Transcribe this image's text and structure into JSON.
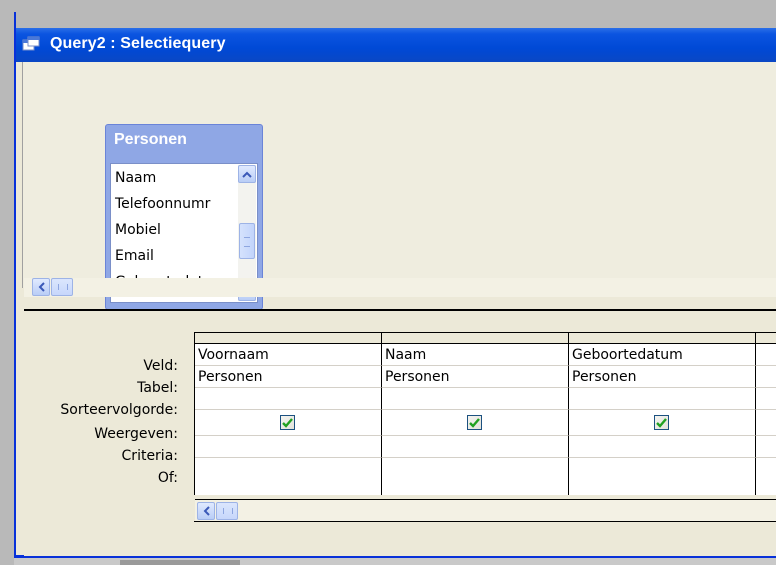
{
  "window": {
    "title": "Query2 : Selectiequery"
  },
  "table_box": {
    "title": "Personen",
    "fields": [
      "Naam",
      "Telefoonnumr",
      "Mobiel",
      "Email",
      "Geboortedatu"
    ]
  },
  "grid": {
    "row_labels": {
      "field": "Veld:",
      "table": "Tabel:",
      "sort": "Sorteervolgorde:",
      "show": "Weergeven:",
      "criteria": "Criteria:",
      "or": "Of:"
    },
    "columns": [
      {
        "field": "Voornaam",
        "table": "Personen",
        "sort": "",
        "show": true,
        "criteria": "",
        "or": ""
      },
      {
        "field": "Naam",
        "table": "Personen",
        "sort": "",
        "show": true,
        "criteria": "",
        "or": ""
      },
      {
        "field": "Geboortedatum",
        "table": "Personen",
        "sort": "",
        "show": true,
        "criteria": "",
        "or": ""
      }
    ]
  },
  "colors": {
    "titlebar": "#0049d6",
    "table_box": "#8fa7e5",
    "checkmark": "#21a121"
  }
}
